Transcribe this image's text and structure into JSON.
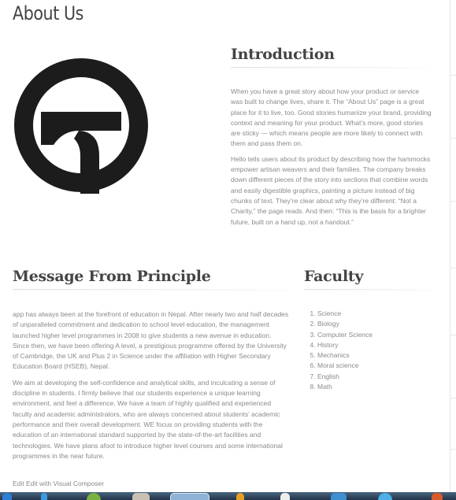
{
  "page": {
    "title": "About Us"
  },
  "introduction": {
    "heading": "Introduction",
    "paragraphs": [
      "When you have a great story about how your product or service was built to change lives, share it. The “About Us” page is a great place for it to live, too. Good stories humanize your brand, providing context and meaning for your product. What’s more, good stories are sticky — which means people are more likely to connect with them and pass them on.",
      "Hello tells users about its product by describing how the hammocks empower artisan weavers and their families. The company breaks down different pieces of the story into sections that combine words and easily digestible graphics, painting a picture instead of big chunks of text. They’re clear about why they’re different: “Not a Charity,” the page reads. And then: “This is the basis for a brighter future, built on a hand up, not a handout.”"
    ]
  },
  "message": {
    "heading": "Message From Principle",
    "paragraphs": [
      "app has always been at the forefront of education in Nepal. After nearly two and half decades of unparalleled commitment and dedication to school level education, the management launched higher level programmes in 2008 to give students a new avenue in education. Since then, we have been offering A level, a prestigious programme offered by the University of Cambridge, the UK and Plus 2 in Science under the affiliation with Higher Secondary Education Board (HSEB), Nepal.",
      "We aim at developing the self-confidence and analytical skills, and inculcating a sense of discipline in students. I firmly believe that our students experience a unique learning environment, and feel a difference. We have a team of highly qualified and experienced faculty and academic administrators, who are always concerned about students’ academic performance and their overall development. WE focus on providing students with the education of an international standard supported by the state-of-the-art facilities and technologies. We have plans afoot to introduce higher level courses and some international programmes in the near future."
    ]
  },
  "faculty": {
    "heading": "Faculty",
    "items": [
      "Science",
      "Biology",
      "Computer Science",
      "History",
      "Mechanics",
      "Moral science",
      "English",
      "Math"
    ]
  },
  "footer": {
    "edit_link": "Edit Edit with Visual Composer"
  },
  "colors": {
    "heading": "#444444",
    "body_text": "#8a8a8a",
    "logo": "#1c1c1c",
    "taskbar": "#2c3e55"
  }
}
